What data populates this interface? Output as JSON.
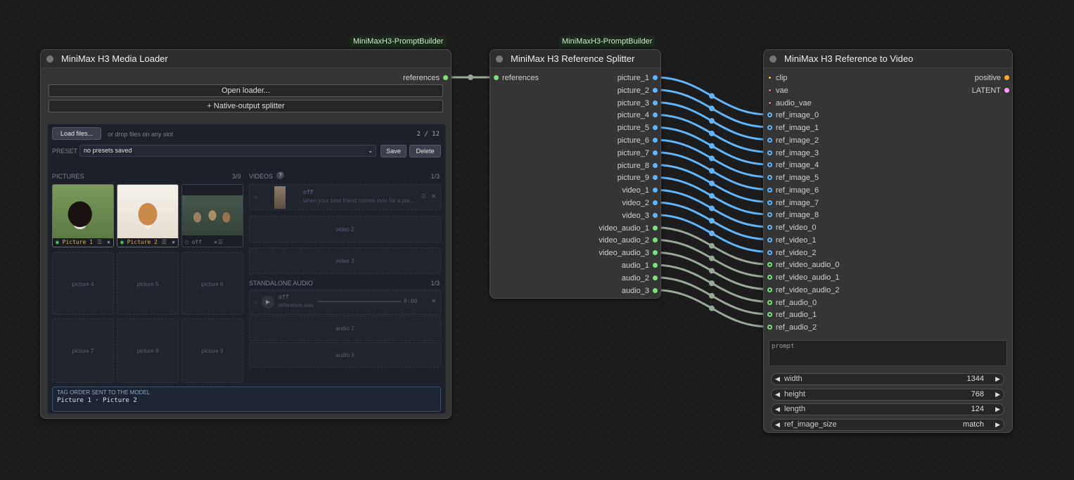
{
  "badges": [
    "MiniMaxH3-PromptBuilder",
    "MiniMaxH3-PromptBuilder"
  ],
  "loader": {
    "title": "MiniMax H3 Media Loader",
    "output": "references",
    "open_btn": "Open loader...",
    "splitter_btn": "+ Native-output splitter",
    "load_btn": "Load files...",
    "drop_hint": "or drop files on any slot",
    "count": "2 / 12",
    "preset_label": "PRESET",
    "preset_value": "no presets saved",
    "save": "Save",
    "delete": "Delete",
    "pictures_label": "PICTURES",
    "pictures_count": "3/9",
    "pictures": [
      {
        "label": "Picture 1"
      },
      {
        "label": "Picture 2"
      },
      {
        "label": "off"
      }
    ],
    "empty_pictures": [
      "picture 4",
      "picture 5",
      "picture 6",
      "picture 7",
      "picture 8",
      "picture 9"
    ],
    "videos_label": "VIDEOS",
    "videos_help": "?",
    "videos_count": "1/3",
    "video1": {
      "state": "off",
      "desc": "when your best friend comes over for a pla..."
    },
    "empty_videos": [
      "video 2",
      "video 3"
    ],
    "audio_label": "STANDALONE AUDIO",
    "audio_count": "1/3",
    "audio1": {
      "state": "off",
      "file": "reference.wav",
      "time": "0:00"
    },
    "empty_audio": [
      "audio 2",
      "audio 3"
    ],
    "tag_title": "TAG ORDER SENT TO THE MODEL",
    "tag_value": "Picture 1 · Picture 2"
  },
  "splitter": {
    "title": "MiniMax H3 Reference Splitter",
    "input": "references",
    "outputs": [
      "picture_1",
      "picture_2",
      "picture_3",
      "picture_4",
      "picture_5",
      "picture_6",
      "picture_7",
      "picture_8",
      "picture_9",
      "video_1",
      "video_2",
      "video_3",
      "video_audio_1",
      "video_audio_2",
      "video_audio_3",
      "audio_1",
      "audio_2",
      "audio_3"
    ]
  },
  "r2v": {
    "title": "MiniMax H3 Reference to Video",
    "inputs": [
      "clip",
      "vae",
      "audio_vae",
      "ref_image_0",
      "ref_image_1",
      "ref_image_2",
      "ref_image_3",
      "ref_image_4",
      "ref_image_5",
      "ref_image_6",
      "ref_image_7",
      "ref_image_8",
      "ref_video_0",
      "ref_video_1",
      "ref_video_2",
      "ref_video_audio_0",
      "ref_video_audio_1",
      "ref_video_audio_2",
      "ref_audio_0",
      "ref_audio_1",
      "ref_audio_2"
    ],
    "outputs": [
      "positive",
      "LATENT"
    ],
    "prompt_placeholder": "prompt",
    "widgets": [
      {
        "name": "width",
        "value": "1344"
      },
      {
        "name": "height",
        "value": "768"
      },
      {
        "name": "length",
        "value": "124"
      },
      {
        "name": "ref_image_size",
        "value": "match"
      }
    ],
    "arrow_left": "◀",
    "arrow_right": "▶"
  },
  "colors": {
    "image": "#64b5f6",
    "audio": "#7ee07e",
    "clip": "#ffd500",
    "vae": "#ff6e6e",
    "positive": "#ffa931",
    "latent": "#ff9cf9",
    "link_img": "#64b5f6",
    "link_audio": "#9aa89a"
  }
}
